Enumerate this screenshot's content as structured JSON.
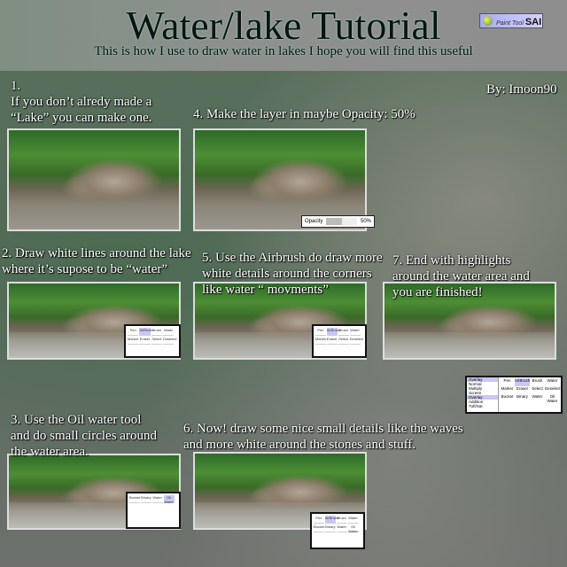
{
  "header": {
    "title": "Water/lake Tutorial",
    "subtitle": "This is how I use to draw water in lakes I hope you will find this useful",
    "logo": "PaintTool SAI"
  },
  "author": "By: Imoon90",
  "steps": [
    {
      "lines": [
        "1.",
        "If you don’t alredy made a",
        "“Lake” you can make one."
      ]
    },
    {
      "lines": [
        "2. Draw white lines around the lake",
        " where it’s supose to be “water”"
      ]
    },
    {
      "lines": [
        "3. Use the Oil water tool",
        "and do small circles around",
        "the water area."
      ]
    },
    {
      "lines": [
        "4. Make the layer in maybe Opacity: 50%"
      ]
    },
    {
      "lines": [
        "5. Use the Airbrush do draw more",
        "white details around the corners",
        "like water “ movments”"
      ]
    },
    {
      "lines": [
        "6. Now! draw some nice small details like the waves",
        "and more white around the stones and stuff."
      ]
    },
    {
      "lines": [
        "7. End with highlights",
        "around the water area and",
        "you are finished!"
      ]
    }
  ],
  "opacity_widget": {
    "label": "Opacity",
    "value": "50%",
    "fraction": 0.5
  },
  "tools": [
    "Pen",
    "AirBrush",
    "Brush",
    "Water",
    "Marker",
    "Eraser",
    "Select",
    "Deselect",
    "Bucket",
    "Binary",
    "Water",
    "Oil Water"
  ],
  "blend_modes": {
    "current": "Overlay",
    "options": [
      "Normal",
      "Multiply",
      "Screen",
      "Overlay",
      "Addition",
      "Tuft/Sat"
    ]
  }
}
